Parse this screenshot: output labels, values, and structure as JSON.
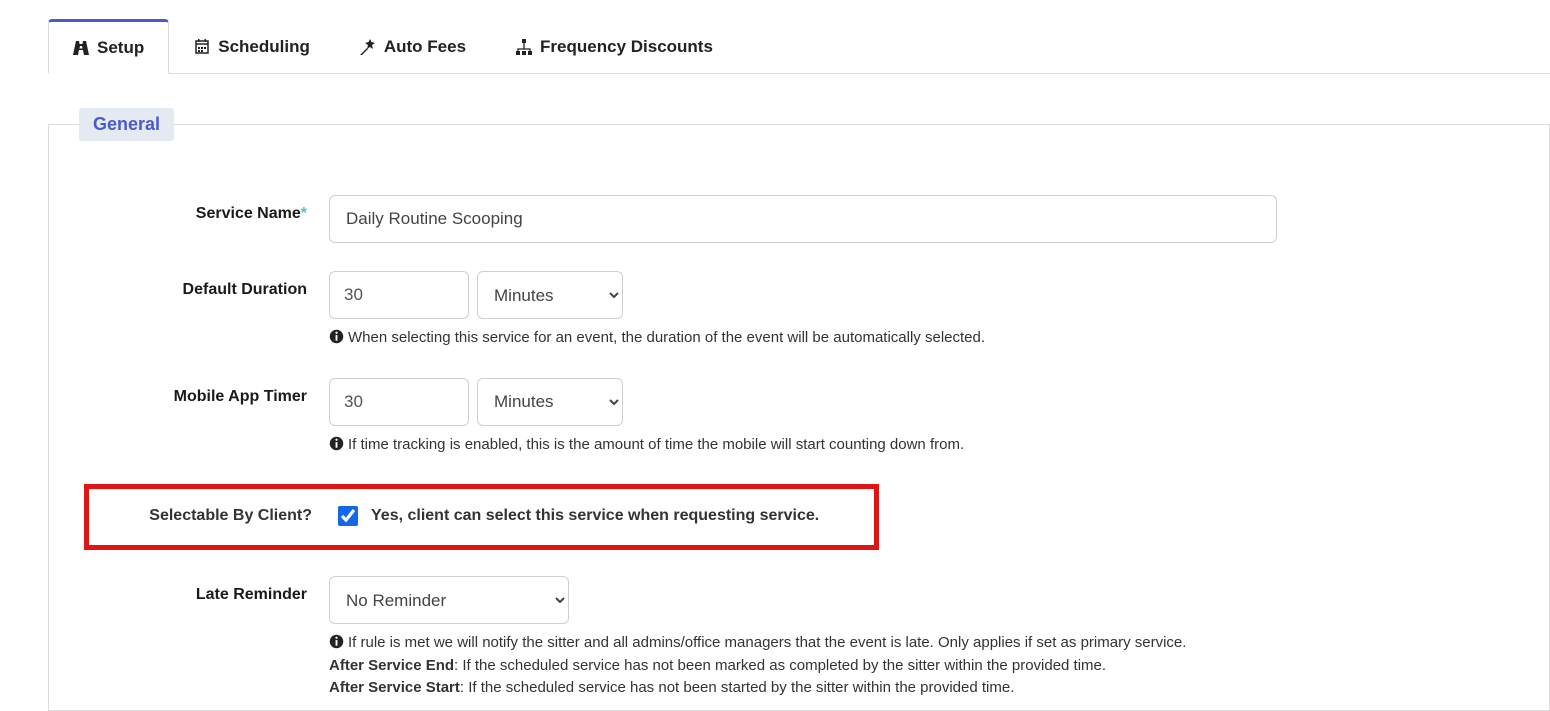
{
  "tabs": {
    "setup": {
      "label": "Setup"
    },
    "sched": {
      "label": "Scheduling"
    },
    "autofees": {
      "label": "Auto Fees"
    },
    "freq": {
      "label": "Frequency Discounts"
    }
  },
  "section": {
    "title": "General"
  },
  "service_name": {
    "label": "Service Name",
    "value": "Daily Routine Scooping"
  },
  "default_duration": {
    "label": "Default Duration",
    "value": "30",
    "unit": "Minutes",
    "helper": "When selecting this service for an event, the duration of the event will be automatically selected."
  },
  "mobile_timer": {
    "label": "Mobile App Timer",
    "value": "30",
    "unit": "Minutes",
    "helper": "If time tracking is enabled, this is the amount of time the mobile will start counting down from."
  },
  "selectable": {
    "label": "Selectable By Client?",
    "checkbox_label": "Yes, client can select this service when requesting service."
  },
  "late_reminder": {
    "label": "Late Reminder",
    "value": "No Reminder",
    "helper_intro": "If rule is met we will notify the sitter and all admins/office managers that the event is late. Only applies if set as primary service.",
    "after_end_label": "After Service End",
    "after_end_text": ": If the scheduled service has not been marked as completed by the sitter within the provided time.",
    "after_start_label": "After Service Start",
    "after_start_text": ": If the scheduled service has not been started by the sitter within the provided time."
  }
}
